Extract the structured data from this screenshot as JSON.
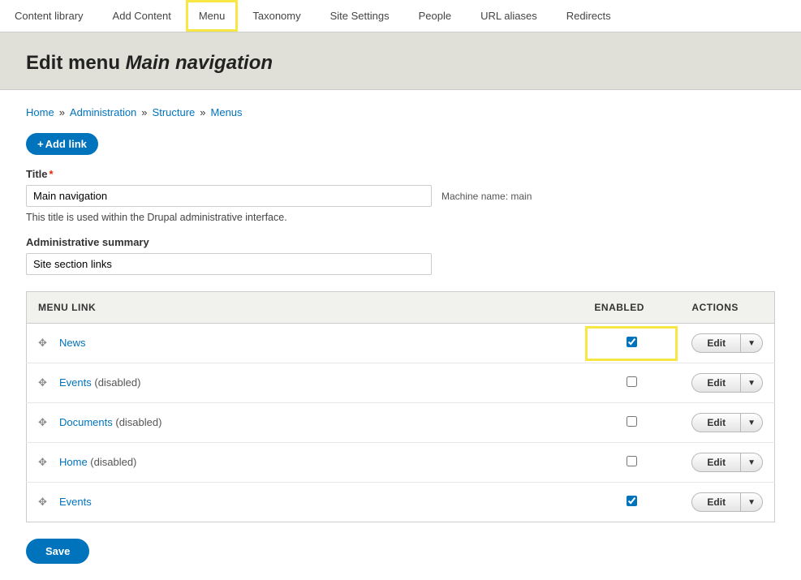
{
  "top_nav": [
    {
      "label": "Content library",
      "highlighted": false
    },
    {
      "label": "Add Content",
      "highlighted": false
    },
    {
      "label": "Menu",
      "highlighted": true
    },
    {
      "label": "Taxonomy",
      "highlighted": false
    },
    {
      "label": "Site Settings",
      "highlighted": false
    },
    {
      "label": "People",
      "highlighted": false
    },
    {
      "label": "URL aliases",
      "highlighted": false
    },
    {
      "label": "Redirects",
      "highlighted": false
    }
  ],
  "page_title_prefix": "Edit menu ",
  "page_title_name": "Main navigation",
  "breadcrumb": {
    "items": [
      "Home",
      "Administration",
      "Structure",
      "Menus"
    ]
  },
  "add_link_label": "Add link",
  "title_field": {
    "label": "Title",
    "value": "Main navigation",
    "machine_name_prefix": "Machine name: ",
    "machine_name": "main",
    "help": "This title is used within the Drupal administrative interface."
  },
  "summary_field": {
    "label": "Administrative summary",
    "value": "Site section links"
  },
  "table": {
    "headers": {
      "link": "MENU LINK",
      "enabled": "ENABLED",
      "actions": "ACTIONS"
    },
    "edit_label": "Edit",
    "disabled_suffix": " (disabled)",
    "rows": [
      {
        "name": "News",
        "enabled": true,
        "disabled_tag": false,
        "highlight_enabled": true
      },
      {
        "name": "Events",
        "enabled": false,
        "disabled_tag": true,
        "highlight_enabled": false
      },
      {
        "name": "Documents",
        "enabled": false,
        "disabled_tag": true,
        "highlight_enabled": false
      },
      {
        "name": "Home",
        "enabled": false,
        "disabled_tag": true,
        "highlight_enabled": false
      },
      {
        "name": "Events",
        "enabled": true,
        "disabled_tag": false,
        "highlight_enabled": false
      }
    ]
  },
  "save_label": "Save"
}
